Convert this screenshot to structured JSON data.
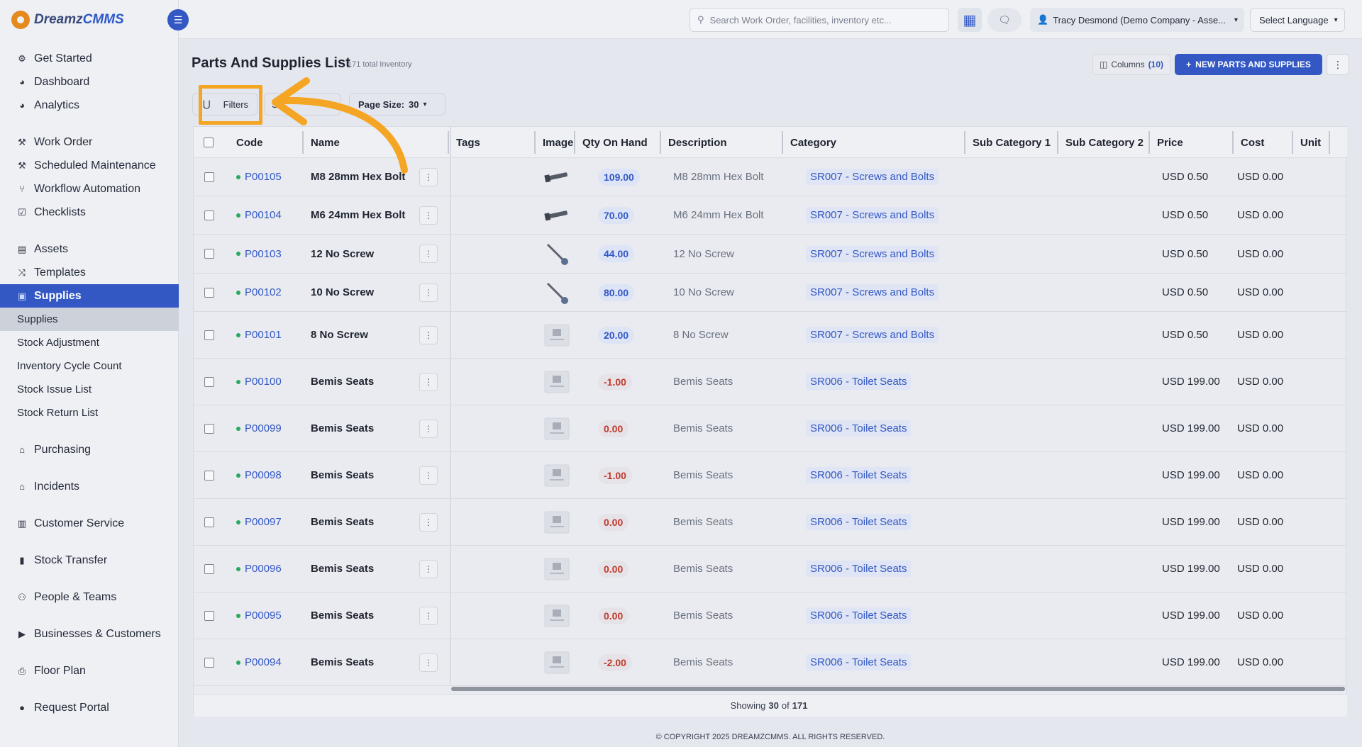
{
  "app": {
    "logo_text": "Dreamz",
    "logo_accent": "CMMS"
  },
  "topbar": {
    "search_placeholder": "Search Work Order, facilities, inventory etc...",
    "user_label": "Tracy Desmond (Demo Company - Asse...",
    "language_label": "Select Language"
  },
  "sidebar": {
    "groups": [
      [
        {
          "label": "Get Started",
          "icon": "gears-icon"
        },
        {
          "label": "Dashboard",
          "icon": "palette-icon"
        },
        {
          "label": "Analytics",
          "icon": "palette-icon"
        }
      ],
      [
        {
          "label": "Work Order",
          "icon": "wrench-icon"
        },
        {
          "label": "Scheduled Maintenance",
          "icon": "wrench-icon"
        },
        {
          "label": "Workflow Automation",
          "icon": "flow-icon"
        },
        {
          "label": "Checklists",
          "icon": "checkbox-icon"
        }
      ],
      [
        {
          "label": "Assets",
          "icon": "cabinet-icon"
        },
        {
          "label": "Templates",
          "icon": "shuffle-icon"
        },
        {
          "label": "Supplies",
          "icon": "box-icon",
          "active": true
        }
      ]
    ],
    "sub_items": [
      "Supplies",
      "Stock Adjustment",
      "Inventory Cycle Count",
      "Stock Issue List",
      "Stock Return List"
    ],
    "bottom": [
      {
        "label": "Purchasing",
        "icon": "cart-icon"
      },
      {
        "label": "Incidents",
        "icon": "cart-icon"
      },
      {
        "label": "Customer Service",
        "icon": "document-icon"
      },
      {
        "label": "Stock Transfer",
        "icon": "truck-icon"
      },
      {
        "label": "People & Teams",
        "icon": "people-icon"
      },
      {
        "label": "Businesses & Customers",
        "icon": "video-icon"
      },
      {
        "label": "Floor Plan",
        "icon": "printer-icon"
      },
      {
        "label": "Request Portal",
        "icon": "chat-icon"
      }
    ]
  },
  "page": {
    "title": "Parts And Supplies List",
    "subtitle": "171 total Inventory",
    "columns_label": "Columns",
    "columns_count": "(10)",
    "new_button": "NEW PARTS AND SUPPLIES",
    "filters_label": "Filters",
    "sort_label": "S",
    "page_size_label": "Page Size:",
    "page_size_value": "30"
  },
  "table": {
    "headers": [
      "Code",
      "Name",
      "Tags",
      "Image",
      "Qty On Hand",
      "Description",
      "Category",
      "Sub Category 1",
      "Sub Category 2",
      "Price",
      "Cost",
      "Unit"
    ],
    "rows": [
      {
        "code": "P00105",
        "name": "M8 28mm Hex Bolt",
        "image": "bolt",
        "qty": "109.00",
        "neg": false,
        "desc": "M8 28mm Hex Bolt",
        "cat": "SR007 - Screws and Bolts",
        "price": "USD 0.50",
        "cost": "USD 0.00"
      },
      {
        "code": "P00104",
        "name": "M6 24mm Hex Bolt",
        "image": "bolt",
        "qty": "70.00",
        "neg": false,
        "desc": "M6 24mm Hex Bolt",
        "cat": "SR007 - Screws and Bolts",
        "price": "USD 0.50",
        "cost": "USD 0.00"
      },
      {
        "code": "P00103",
        "name": "12 No Screw",
        "image": "screw",
        "qty": "44.00",
        "neg": false,
        "desc": "12 No Screw",
        "cat": "SR007 - Screws and Bolts",
        "price": "USD 0.50",
        "cost": "USD 0.00"
      },
      {
        "code": "P00102",
        "name": "10 No Screw",
        "image": "screw",
        "qty": "80.00",
        "neg": false,
        "desc": "10 No Screw",
        "cat": "SR007 - Screws and Bolts",
        "price": "USD 0.50",
        "cost": "USD 0.00"
      },
      {
        "code": "P00101",
        "name": "8 No Screw",
        "image": "none",
        "qty": "20.00",
        "neg": false,
        "desc": "8 No Screw",
        "cat": "SR007 - Screws and Bolts",
        "price": "USD 0.50",
        "cost": "USD 0.00"
      },
      {
        "code": "P00100",
        "name": "Bemis Seats",
        "image": "none",
        "qty": "-1.00",
        "neg": true,
        "desc": "Bemis Seats",
        "cat": "SR006 - Toilet Seats",
        "price": "USD 199.00",
        "cost": "USD 0.00"
      },
      {
        "code": "P00099",
        "name": "Bemis Seats",
        "image": "none",
        "qty": "0.00",
        "neg": true,
        "desc": "Bemis Seats",
        "cat": "SR006 - Toilet Seats",
        "price": "USD 199.00",
        "cost": "USD 0.00"
      },
      {
        "code": "P00098",
        "name": "Bemis Seats",
        "image": "none",
        "qty": "-1.00",
        "neg": true,
        "desc": "Bemis Seats",
        "cat": "SR006 - Toilet Seats",
        "price": "USD 199.00",
        "cost": "USD 0.00"
      },
      {
        "code": "P00097",
        "name": "Bemis Seats",
        "image": "none",
        "qty": "0.00",
        "neg": true,
        "desc": "Bemis Seats",
        "cat": "SR006 - Toilet Seats",
        "price": "USD 199.00",
        "cost": "USD 0.00"
      },
      {
        "code": "P00096",
        "name": "Bemis Seats",
        "image": "none",
        "qty": "0.00",
        "neg": true,
        "desc": "Bemis Seats",
        "cat": "SR006 - Toilet Seats",
        "price": "USD 199.00",
        "cost": "USD 0.00"
      },
      {
        "code": "P00095",
        "name": "Bemis Seats",
        "image": "none",
        "qty": "0.00",
        "neg": true,
        "desc": "Bemis Seats",
        "cat": "SR006 - Toilet Seats",
        "price": "USD 199.00",
        "cost": "USD 0.00"
      },
      {
        "code": "P00094",
        "name": "Bemis Seats",
        "image": "none",
        "qty": "-2.00",
        "neg": true,
        "desc": "Bemis Seats",
        "cat": "SR006 - Toilet Seats",
        "price": "USD 199.00",
        "cost": "USD 0.00"
      }
    ],
    "showing_prefix": "Showing",
    "showing_count": "30",
    "showing_of": "of",
    "showing_total": "171"
  },
  "footer": "© COPYRIGHT 2025 DREAMZCMMS. ALL RIGHTS RESERVED.",
  "colors": {
    "accent": "#3358c4",
    "annotation": "#f5a524",
    "positive_dot": "#2aa860",
    "negative_qty": "#c0392b"
  }
}
